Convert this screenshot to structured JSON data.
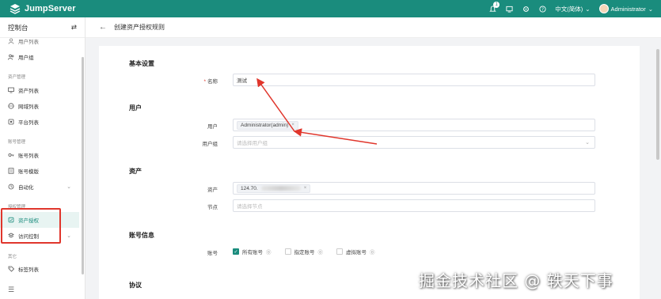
{
  "app": {
    "brand": "JumpServer",
    "brand_color": "#1a8c7d"
  },
  "topbar": {
    "notification_count": "1",
    "language": "中文(简体)",
    "user": "Administrator"
  },
  "sidebar": {
    "title": "控制台",
    "items": [
      {
        "kind": "item",
        "label": "用户列表",
        "icon": "user-icon"
      },
      {
        "kind": "item",
        "label": "用户组",
        "icon": "users-icon"
      },
      {
        "kind": "group",
        "label": "资产管理"
      },
      {
        "kind": "item",
        "label": "资产列表",
        "icon": "monitor-icon"
      },
      {
        "kind": "item",
        "label": "网域列表",
        "icon": "globe-icon"
      },
      {
        "kind": "item",
        "label": "平台列表",
        "icon": "platform-icon"
      },
      {
        "kind": "group",
        "label": "账号管理"
      },
      {
        "kind": "item",
        "label": "账号列表",
        "icon": "key-icon"
      },
      {
        "kind": "item",
        "label": "账号模版",
        "icon": "template-icon"
      },
      {
        "kind": "item",
        "label": "自动化",
        "icon": "automation-icon",
        "expandable": true
      },
      {
        "kind": "group",
        "label": "授权管理"
      },
      {
        "kind": "item",
        "label": "资产授权",
        "icon": "shield-icon",
        "active": true
      },
      {
        "kind": "item",
        "label": "访问控制",
        "icon": "acl-icon",
        "expandable": true
      },
      {
        "kind": "group",
        "label": "其它"
      },
      {
        "kind": "item",
        "label": "标签列表",
        "icon": "tag-icon"
      }
    ]
  },
  "breadcrumb": {
    "title": "创建资产授权规则"
  },
  "form": {
    "sections": {
      "basic": "基本设置",
      "users": "用户",
      "assets": "资产",
      "accounts": "账号信息",
      "protocol": "协议"
    },
    "name": {
      "label": "名称",
      "value": "测试"
    },
    "user": {
      "label": "用户",
      "tag": "Administrator(admin)"
    },
    "user_group": {
      "label": "用户组",
      "placeholder": "请选择用户组"
    },
    "asset": {
      "label": "资产",
      "tag_prefix": "124.70."
    },
    "node": {
      "label": "节点",
      "placeholder": "请选择节点"
    },
    "account": {
      "label": "账号",
      "options": [
        {
          "label": "所有账号",
          "checked": true
        },
        {
          "label": "指定账号",
          "checked": false
        },
        {
          "label": "虚拟账号",
          "checked": false
        }
      ]
    }
  },
  "watermark": "掘金技术社区 @ 轶天下事"
}
